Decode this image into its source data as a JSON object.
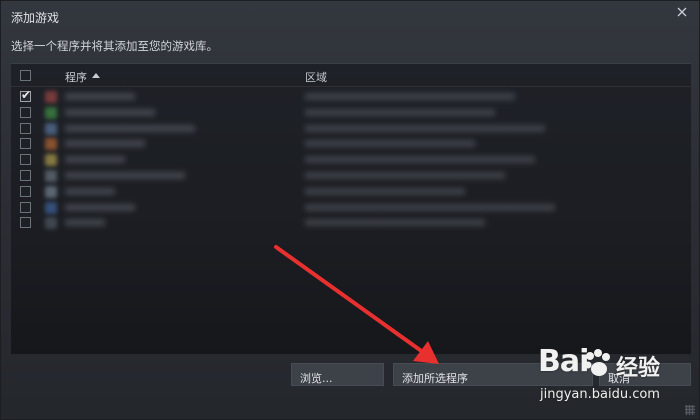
{
  "window": {
    "title": "添加游戏",
    "instructions": "选择一个程序并将其添加至您的游戏库。"
  },
  "table": {
    "col_program": "程序",
    "col_region": "区域",
    "rows": [
      {
        "checked": true,
        "icon_color": "#c0504d"
      },
      {
        "checked": false,
        "icon_color": "#4caf50"
      },
      {
        "checked": false,
        "icon_color": "#6a8fbf"
      },
      {
        "checked": false,
        "icon_color": "#e07b39"
      },
      {
        "checked": false,
        "icon_color": "#d9c15a"
      },
      {
        "checked": false,
        "icon_color": "#7e8a96"
      },
      {
        "checked": false,
        "icon_color": "#8fa0b0"
      },
      {
        "checked": false,
        "icon_color": "#4a78c0"
      },
      {
        "checked": false,
        "icon_color": "#5e6873"
      }
    ]
  },
  "buttons": {
    "browse": "浏览...",
    "add_selected": "添加所选程序",
    "cancel": "取消"
  },
  "annotation": {
    "arrow_color": "#e8302f"
  },
  "watermark": {
    "logo": "Bai",
    "text": "经验",
    "url": "jingyan.baidu.com"
  }
}
